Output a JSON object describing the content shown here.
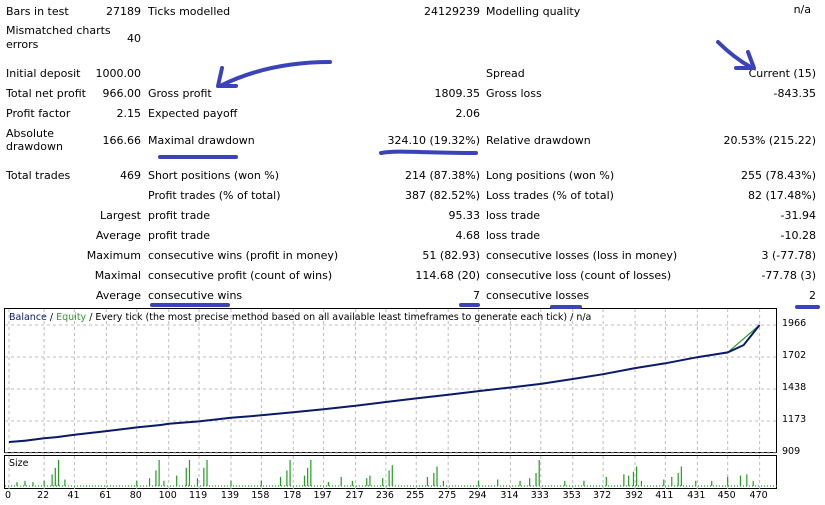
{
  "colors": {
    "balance": "#0a1a6b",
    "equity": "#2e9b2e",
    "size_bars": "#1f9f1f",
    "annotation": "#3a43b8",
    "grid": "#bdbdbd"
  },
  "summary": {
    "bars_in_test": {
      "label": "Bars in test",
      "value": "27189"
    },
    "ticks_modelled": {
      "label": "Ticks modelled",
      "value": "24129239"
    },
    "modelling_quality": {
      "label": "Modelling quality",
      "value": "n/a"
    },
    "mismatched": {
      "label_line1": "Mismatched charts",
      "label_line2": "errors",
      "value": "40"
    },
    "initial_deposit": {
      "label": "Initial deposit",
      "value": "1000.00"
    },
    "spread": {
      "label": "Spread",
      "value": "Current (15)"
    },
    "total_net_profit": {
      "label": "Total net profit",
      "value": "966.00"
    },
    "gross_profit": {
      "label": "Gross profit",
      "value": "1809.35"
    },
    "gross_loss": {
      "label": "Gross loss",
      "value": "-843.35"
    },
    "profit_factor": {
      "label": "Profit factor",
      "value": "2.15"
    },
    "expected_payoff": {
      "label": "Expected payoff",
      "value": "2.06"
    },
    "absolute_drawdown": {
      "label_line1": "Absolute",
      "label_line2": "drawdown",
      "value": "166.66"
    },
    "maximal_drawdown": {
      "label": "Maximal drawdown",
      "value": "324.10 (19.32%)"
    },
    "relative_drawdown": {
      "label": "Relative drawdown",
      "value": "20.53% (215.22)"
    },
    "total_trades": {
      "label": "Total trades",
      "value": "469"
    },
    "short_positions": {
      "label": "Short positions (won %)",
      "value": "214 (87.38%)"
    },
    "long_positions": {
      "label": "Long positions (won %)",
      "value": "255 (78.43%)"
    },
    "profit_trades": {
      "label": "Profit trades (% of total)",
      "value": "387 (82.52%)"
    },
    "loss_trades": {
      "label": "Loss trades (% of total)",
      "value": "82 (17.48%)"
    }
  },
  "detail_rows": [
    {
      "prefix": "Largest",
      "left_label": "profit trade",
      "left_value": "95.33",
      "right_label": "loss trade",
      "right_value": "-31.94"
    },
    {
      "prefix": "Average",
      "left_label": "profit trade",
      "left_value": "4.68",
      "right_label": "loss trade",
      "right_value": "-10.28"
    },
    {
      "prefix": "Maximum",
      "left_label": "consecutive wins (profit in money)",
      "left_value": "51 (82.93)",
      "right_label": "consecutive losses (loss in money)",
      "right_value": "3 (-77.78)"
    },
    {
      "prefix": "Maximal",
      "left_label": "consecutive profit (count of wins)",
      "left_value": "114.68 (20)",
      "right_label": "consecutive loss (count of losses)",
      "right_value": "-77.78 (3)"
    },
    {
      "prefix": "Average",
      "left_label": "consecutive wins",
      "left_value": "7",
      "right_label": "consecutive losses",
      "right_value": "2"
    }
  ],
  "chart": {
    "legend_balance": "Balance",
    "legend_sep1": " / ",
    "legend_equity": "Equity",
    "legend_rest": " / Every tick (the most precise method based on all available least timeframes to generate each tick) / n/a",
    "size_label": "Size"
  },
  "chart_data": {
    "type": "line",
    "title": "Balance / Equity / Every tick (the most precise method based on all available least timeframes to generate each tick) / n/a",
    "xlabel": "",
    "ylabel": "",
    "x_ticks": [
      0,
      22,
      41,
      61,
      80,
      100,
      119,
      139,
      158,
      178,
      197,
      217,
      236,
      255,
      275,
      294,
      314,
      333,
      353,
      372,
      392,
      411,
      431,
      450,
      470
    ],
    "y_ticks": [
      909,
      1173,
      1438,
      1702,
      1966
    ],
    "xlim": [
      0,
      474
    ],
    "ylim": [
      909,
      1966
    ],
    "grid": true,
    "series": [
      {
        "name": "Balance",
        "points": [
          [
            0,
            1000
          ],
          [
            10,
            1010
          ],
          [
            22,
            1030
          ],
          [
            30,
            1040
          ],
          [
            41,
            1060
          ],
          [
            61,
            1090
          ],
          [
            80,
            1120
          ],
          [
            95,
            1140
          ],
          [
            100,
            1150
          ],
          [
            119,
            1170
          ],
          [
            139,
            1200
          ],
          [
            158,
            1220
          ],
          [
            178,
            1245
          ],
          [
            197,
            1270
          ],
          [
            217,
            1300
          ],
          [
            236,
            1330
          ],
          [
            255,
            1360
          ],
          [
            275,
            1390
          ],
          [
            294,
            1420
          ],
          [
            314,
            1450
          ],
          [
            333,
            1480
          ],
          [
            353,
            1520
          ],
          [
            372,
            1560
          ],
          [
            392,
            1610
          ],
          [
            411,
            1650
          ],
          [
            431,
            1700
          ],
          [
            450,
            1740
          ],
          [
            460,
            1800
          ],
          [
            470,
            1966
          ]
        ]
      },
      {
        "name": "Equity",
        "points": [
          [
            0,
            1000
          ],
          [
            22,
            1030
          ],
          [
            41,
            1060
          ],
          [
            61,
            1090
          ],
          [
            80,
            1120
          ],
          [
            100,
            1150
          ],
          [
            119,
            1170
          ],
          [
            139,
            1200
          ],
          [
            158,
            1220
          ],
          [
            178,
            1245
          ],
          [
            197,
            1270
          ],
          [
            217,
            1300
          ],
          [
            236,
            1330
          ],
          [
            255,
            1360
          ],
          [
            275,
            1390
          ],
          [
            294,
            1420
          ],
          [
            314,
            1450
          ],
          [
            333,
            1480
          ],
          [
            353,
            1520
          ],
          [
            372,
            1560
          ],
          [
            392,
            1610
          ],
          [
            411,
            1650
          ],
          [
            431,
            1700
          ],
          [
            450,
            1740
          ],
          [
            470,
            1966
          ]
        ]
      }
    ],
    "size_series": {
      "name": "Size",
      "spikes": [
        [
          5,
          0.15
        ],
        [
          10,
          0.2
        ],
        [
          15,
          0.15
        ],
        [
          22,
          0.2
        ],
        [
          27,
          0.45
        ],
        [
          29,
          0.7
        ],
        [
          31,
          1.0
        ],
        [
          35,
          0.25
        ],
        [
          80,
          0.2
        ],
        [
          88,
          0.3
        ],
        [
          92,
          0.6
        ],
        [
          94,
          1.0
        ],
        [
          97,
          0.2
        ],
        [
          105,
          0.4
        ],
        [
          111,
          0.7
        ],
        [
          113,
          1.0
        ],
        [
          118,
          0.3
        ],
        [
          122,
          0.7
        ],
        [
          124,
          1.0
        ],
        [
          139,
          0.2
        ],
        [
          158,
          0.2
        ],
        [
          170,
          0.35
        ],
        [
          174,
          0.6
        ],
        [
          176,
          1.0
        ],
        [
          185,
          0.4
        ],
        [
          187,
          0.7
        ],
        [
          189,
          1.0
        ],
        [
          200,
          0.15
        ],
        [
          208,
          0.35
        ],
        [
          215,
          0.2
        ],
        [
          224,
          0.3
        ],
        [
          226,
          0.4
        ],
        [
          234,
          0.3
        ],
        [
          238,
          0.6
        ],
        [
          240,
          0.8
        ],
        [
          262,
          0.35
        ],
        [
          266,
          0.5
        ],
        [
          268,
          0.75
        ],
        [
          272,
          0.2
        ],
        [
          294,
          0.2
        ],
        [
          306,
          0.25
        ],
        [
          320,
          0.2
        ],
        [
          326,
          0.3
        ],
        [
          330,
          0.5
        ],
        [
          332,
          1.0
        ],
        [
          348,
          0.2
        ],
        [
          360,
          0.2
        ],
        [
          374,
          0.35
        ],
        [
          385,
          0.45
        ],
        [
          388,
          0.4
        ],
        [
          391,
          0.55
        ],
        [
          393,
          0.75
        ],
        [
          396,
          0.2
        ],
        [
          410,
          0.25
        ],
        [
          415,
          0.35
        ],
        [
          419,
          0.5
        ],
        [
          421,
          0.75
        ],
        [
          430,
          0.2
        ],
        [
          440,
          0.2
        ],
        [
          450,
          0.35
        ],
        [
          458,
          0.4
        ],
        [
          462,
          0.45
        ],
        [
          466,
          0.2
        ]
      ]
    }
  }
}
